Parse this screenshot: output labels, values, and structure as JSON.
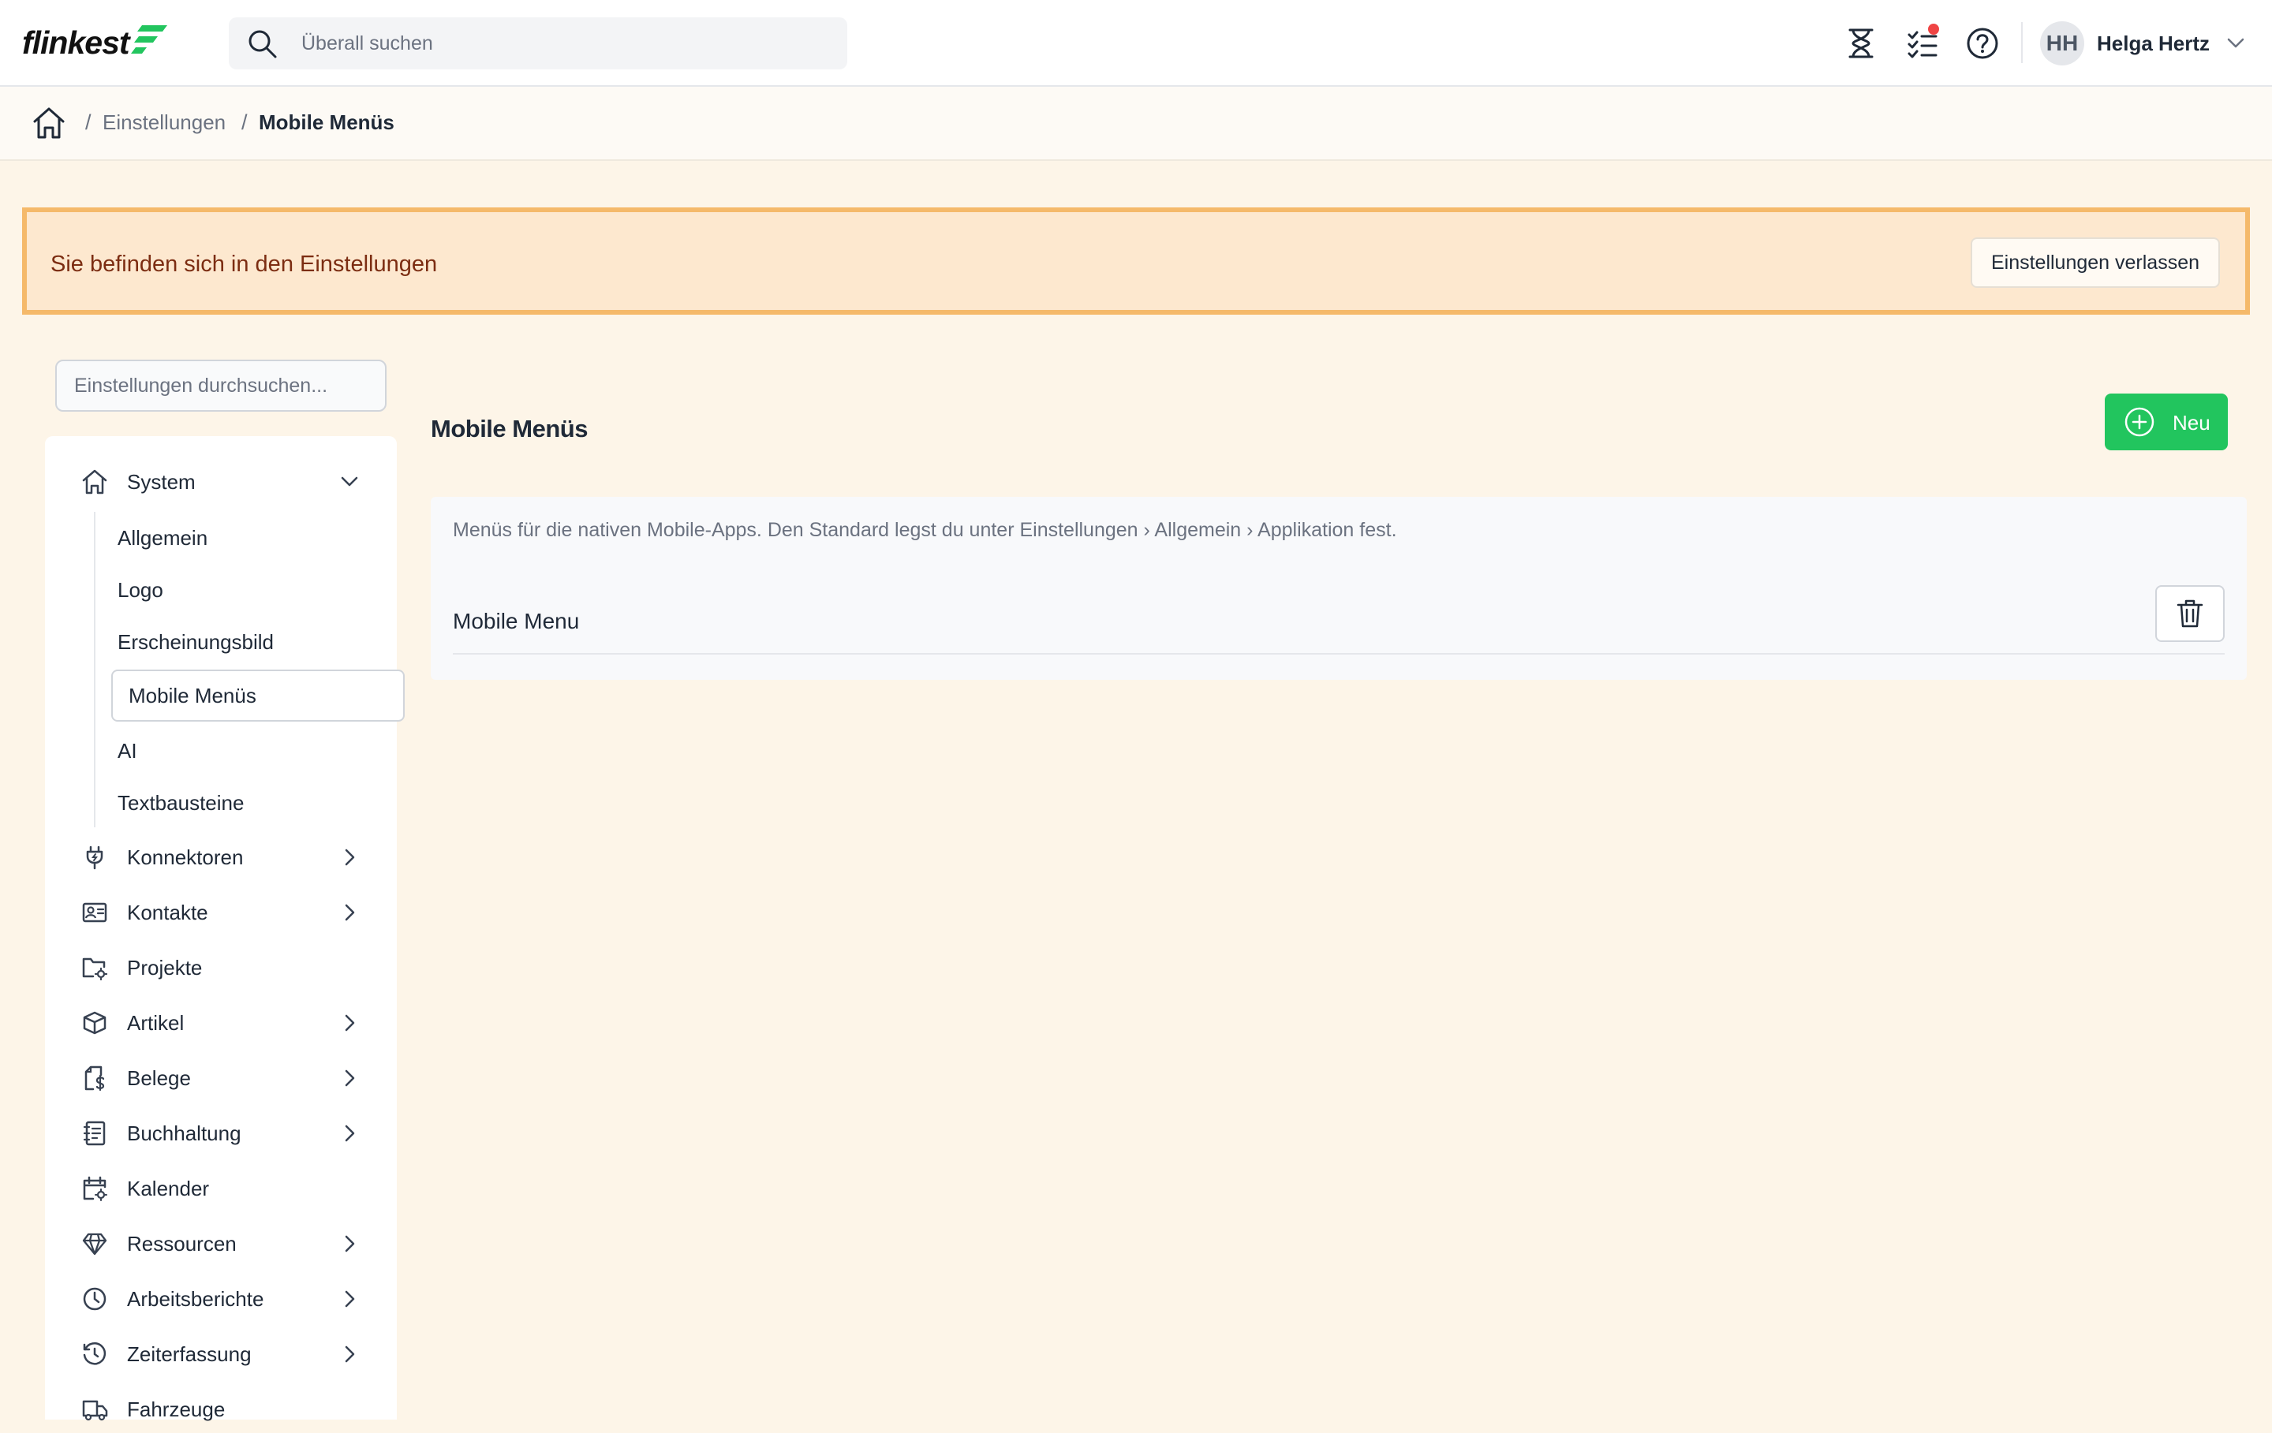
{
  "app": {
    "brand": "flinkest",
    "accent_color": "#22c55e"
  },
  "topbar": {
    "search_placeholder": "Überall suchen",
    "icons": [
      "hourglass-icon",
      "task-list-icon",
      "help-icon"
    ],
    "notification_indicator": true,
    "user": {
      "initials": "HH",
      "name": "Helga Hertz"
    }
  },
  "breadcrumb": {
    "home_icon": "home-icon",
    "items": [
      "Einstellungen",
      "Mobile Menüs"
    ]
  },
  "banner": {
    "text": "Sie befinden sich in den Einstellungen",
    "button": "Einstellungen verlassen"
  },
  "sidebar": {
    "search_placeholder": "Einstellungen durchsuchen...",
    "system": {
      "label": "System",
      "children": [
        "Allgemein",
        "Logo",
        "Erscheinungsbild",
        "Mobile Menüs",
        "AI",
        "Textbausteine"
      ],
      "active": "Mobile Menüs"
    },
    "items": [
      {
        "label": "Konnektoren",
        "icon": "plug-icon",
        "expandable": true
      },
      {
        "label": "Kontakte",
        "icon": "contact-card-icon",
        "expandable": true
      },
      {
        "label": "Projekte",
        "icon": "folder-settings-icon",
        "expandable": false
      },
      {
        "label": "Artikel",
        "icon": "cube-icon",
        "expandable": true
      },
      {
        "label": "Belege",
        "icon": "receipt-icon",
        "expandable": true
      },
      {
        "label": "Buchhaltung",
        "icon": "ledger-icon",
        "expandable": true
      },
      {
        "label": "Kalender",
        "icon": "calendar-icon",
        "expandable": false
      },
      {
        "label": "Ressourcen",
        "icon": "diamond-icon",
        "expandable": true
      },
      {
        "label": "Arbeitsberichte",
        "icon": "clock-icon",
        "expandable": true
      },
      {
        "label": "Zeiterfassung",
        "icon": "history-icon",
        "expandable": true
      },
      {
        "label": "Fahrzeuge",
        "icon": "truck-icon",
        "expandable": false
      }
    ]
  },
  "main": {
    "title": "Mobile Menüs",
    "new_button": "Neu",
    "description": "Menüs für die nativen Mobile-Apps. Den Standard legst du unter Einstellungen › Allgemein › Applikation fest.",
    "menus": [
      {
        "name": "Mobile Menu"
      }
    ]
  }
}
